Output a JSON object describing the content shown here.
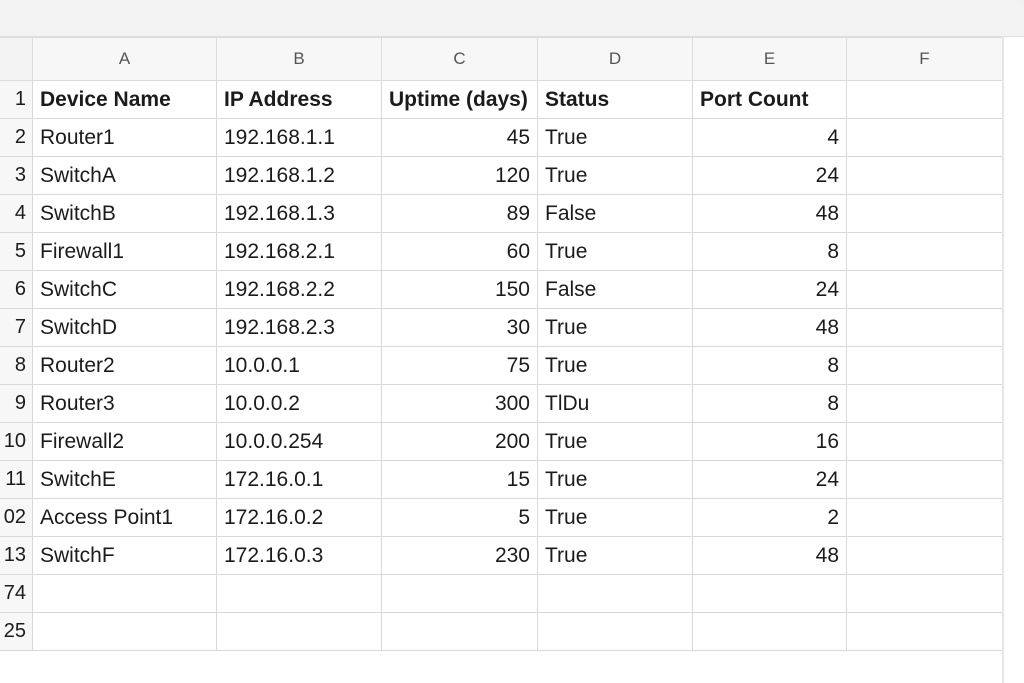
{
  "columns": [
    "A",
    "B",
    "C",
    "D",
    "E",
    "F"
  ],
  "header_row": {
    "row_number": "1",
    "cells": [
      "Device Name",
      "IP Address",
      "Uptime (days)",
      "Status",
      "Port Count",
      ""
    ]
  },
  "rows": [
    {
      "num": "2",
      "device": "Router1",
      "ip": "192.168.1.1",
      "uptime": "45",
      "status": "True",
      "ports": "4"
    },
    {
      "num": "3",
      "device": "SwitchA",
      "ip": "192.168.1.2",
      "uptime": "120",
      "status": "True",
      "ports": "24"
    },
    {
      "num": "4",
      "device": "SwitchB",
      "ip": "192.168.1.3",
      "uptime": "89",
      "status": "False",
      "ports": "48"
    },
    {
      "num": "5",
      "device": "Firewall1",
      "ip": "192.168.2.1",
      "uptime": "60",
      "status": "True",
      "ports": "8"
    },
    {
      "num": "6",
      "device": "SwitchC",
      "ip": "192.168.2.2",
      "uptime": "150",
      "status": "False",
      "ports": "24"
    },
    {
      "num": "7",
      "device": "SwitchD",
      "ip": "192.168.2.3",
      "uptime": "30",
      "status": "True",
      "ports": "48"
    },
    {
      "num": "8",
      "device": "Router2",
      "ip": "10.0.0.1",
      "uptime": "75",
      "status": "True",
      "ports": "8"
    },
    {
      "num": "9",
      "device": "Router3",
      "ip": "10.0.0.2",
      "uptime": "300",
      "status": "TlDu",
      "ports": "8"
    },
    {
      "num": "10",
      "device": "Firewall2",
      "ip": "10.0.0.254",
      "uptime": "200",
      "status": "True",
      "ports": "16"
    },
    {
      "num": "11",
      "device": "SwitchE",
      "ip": "172.16.0.1",
      "uptime": "15",
      "status": "True",
      "ports": "24"
    },
    {
      "num": "02",
      "device": "Access Point1",
      "ip": "172.16.0.2",
      "uptime": "5",
      "status": "True",
      "ports": "2"
    },
    {
      "num": "13",
      "device": "SwitchF",
      "ip": "172.16.0.3",
      "uptime": "230",
      "status": "True",
      "ports": "48"
    }
  ],
  "empty_rows": [
    "74",
    "25"
  ]
}
